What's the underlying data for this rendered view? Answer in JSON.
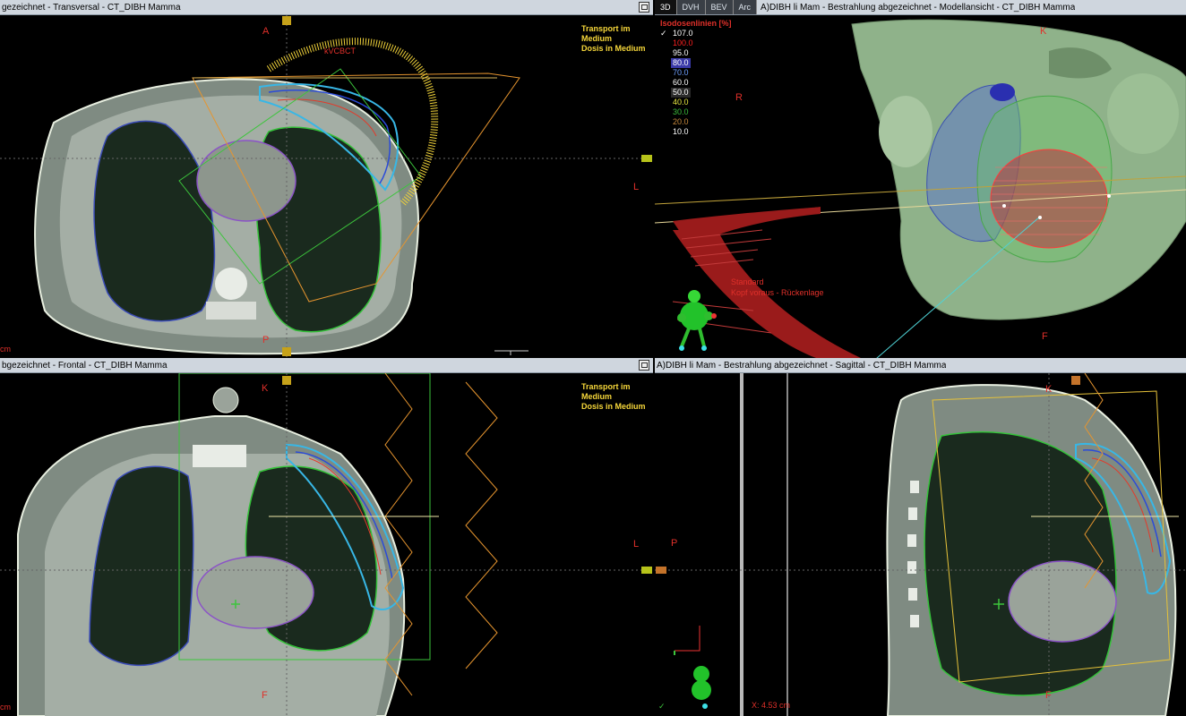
{
  "panes": {
    "transversal": {
      "title": "gezeichnet - Transversal - CT_DIBH Mamma"
    },
    "model3d": {
      "title": "A)DIBH li Mam - Bestrahlung abgezeichnet - Modellansicht - CT_DIBH Mamma"
    },
    "frontal": {
      "title": "bgezeichnet - Frontal - CT_DIBH Mamma"
    },
    "sagittal": {
      "title": "A)DIBH li Mam  -  Bestrahlung abgezeichnet - Sagittal - CT_DIBH Mamma"
    }
  },
  "tabs": [
    "3D",
    "DVH",
    "BEV",
    "Arc"
  ],
  "overlay": {
    "line1": "Transport im",
    "line2": "Medium",
    "line3": "Dosis in Medium"
  },
  "orientation": {
    "A": "A",
    "P": "P",
    "L": "L",
    "R": "R",
    "K": "K",
    "F": "F"
  },
  "kv_label": "kVCBCT",
  "scale_unit": "cm",
  "isodose": {
    "header": "Isodosenlinien [%]",
    "levels": [
      {
        "value": "107.0",
        "color": "#ffffff",
        "bg": "transparent",
        "checked": true
      },
      {
        "value": "100.0",
        "color": "#ff2020",
        "bg": "transparent",
        "checked": false
      },
      {
        "value": "95.0",
        "color": "#ffffff",
        "bg": "transparent",
        "checked": false
      },
      {
        "value": "80.0",
        "color": "#ffffff",
        "bg": "#3a3aa8",
        "checked": false
      },
      {
        "value": "70.0",
        "color": "#6ea0ff",
        "bg": "transparent",
        "checked": false
      },
      {
        "value": "60.0",
        "color": "#ffffff",
        "bg": "transparent",
        "checked": false
      },
      {
        "value": "50.0",
        "color": "#ffffff",
        "bg": "#2a2a2a",
        "checked": false
      },
      {
        "value": "40.0",
        "color": "#e6e640",
        "bg": "transparent",
        "checked": false
      },
      {
        "value": "30.0",
        "color": "#3cbc3c",
        "bg": "transparent",
        "checked": false
      },
      {
        "value": "20.0",
        "color": "#c88a3c",
        "bg": "transparent",
        "checked": false
      },
      {
        "value": "10.0",
        "color": "#ffffff",
        "bg": "transparent",
        "checked": false
      }
    ]
  },
  "patient": {
    "line1": "Standard",
    "line2": "Kopf voraus - Rückenlage"
  },
  "sagittal_x": "X: 4.53 cm",
  "check_mark": "✓"
}
